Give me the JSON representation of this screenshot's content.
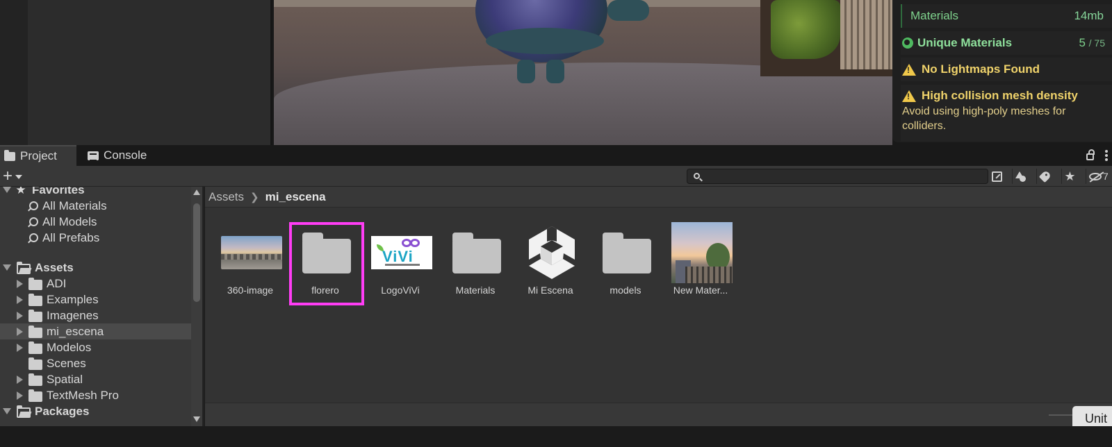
{
  "stats": {
    "materials": {
      "label": "Materials",
      "value": "14mb"
    },
    "unique_materials": {
      "label": "Unique Materials",
      "count": "5",
      "max": "/ 75"
    },
    "warnings": [
      {
        "title": "No Lightmaps Found"
      },
      {
        "title": "High collision mesh density",
        "desc": "Avoid using high-poly meshes for colliders."
      }
    ]
  },
  "tabs": {
    "project": "Project",
    "console": "Console"
  },
  "toolbar": {
    "add_label": "+",
    "search_value": "",
    "hidden_count": "7"
  },
  "tree": {
    "favorites": {
      "label": "Favorites",
      "items": [
        "All Materials",
        "All Models",
        "All Prefabs"
      ]
    },
    "assets": {
      "label": "Assets",
      "items": [
        "ADI",
        "Examples",
        "Imagenes",
        "mi_escena",
        "Modelos",
        "Scenes",
        "Spatial",
        "TextMesh Pro"
      ]
    },
    "packages": {
      "label": "Packages"
    }
  },
  "breadcrumb": {
    "root": "Assets",
    "current": "mi_escena"
  },
  "assets_grid": [
    {
      "name": "360-image",
      "kind": "image"
    },
    {
      "name": "florero",
      "kind": "folder"
    },
    {
      "name": "LogoViVi",
      "kind": "image"
    },
    {
      "name": "Materials",
      "kind": "folder"
    },
    {
      "name": "Mi Escena",
      "kind": "scene"
    },
    {
      "name": "models",
      "kind": "folder"
    },
    {
      "name": "New Mater...",
      "kind": "material"
    }
  ],
  "logo": {
    "text": "ViVi"
  },
  "unity_button": {
    "label": "Unit"
  },
  "colors": {
    "highlight": "#ff3df5",
    "warning": "#f0d36b",
    "ok": "#7fd38d"
  }
}
